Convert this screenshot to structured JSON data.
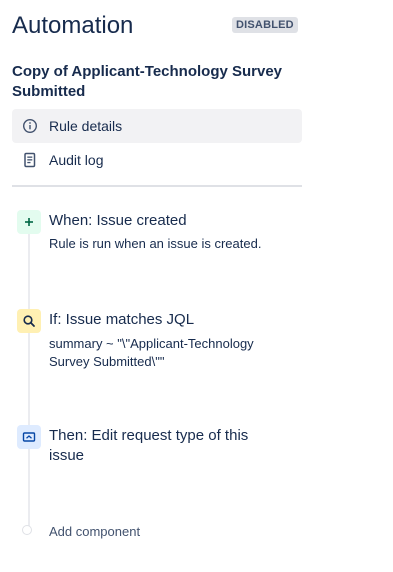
{
  "header": {
    "title": "Automation",
    "status": "DISABLED"
  },
  "rule": {
    "name": "Copy of Applicant-Technology Survey Submitted"
  },
  "nav": {
    "items": [
      {
        "label": "Rule details",
        "icon": "info-icon",
        "active": true
      },
      {
        "label": "Audit log",
        "icon": "document-icon",
        "active": false
      }
    ]
  },
  "components": [
    {
      "kind": "trigger",
      "icon": "plus-icon",
      "color": "#e3fcef",
      "title": "When: Issue created",
      "description": "Rule is run when an issue is created."
    },
    {
      "kind": "condition",
      "icon": "search-icon",
      "color": "#fff0b3",
      "title": "If: Issue matches JQL",
      "description": "summary ~ \"\\\"Applicant-Technology Survey Submitted\\\"\""
    },
    {
      "kind": "action",
      "icon": "edit-request-type-icon",
      "color": "#deebff",
      "title": "Then: Edit request type of this issue",
      "description": ""
    }
  ],
  "add_component": {
    "label": "Add component"
  }
}
